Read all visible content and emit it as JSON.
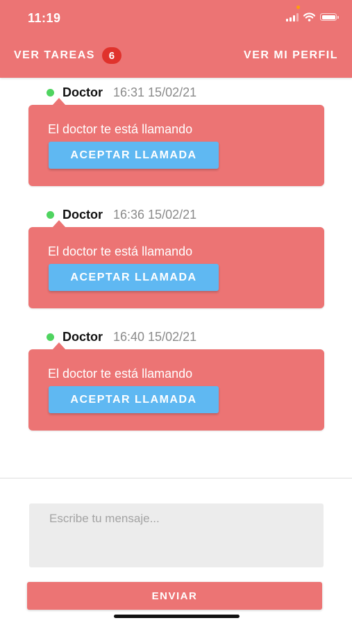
{
  "status_bar": {
    "time": "11:19",
    "icons": [
      "cellular-signal-icon",
      "wifi-icon",
      "battery-icon"
    ]
  },
  "header": {
    "tasks_label": "VER TAREAS",
    "tasks_count": "6",
    "profile_label": "VER MI PERFIL"
  },
  "messages": [
    {
      "sender": "Doctor",
      "time": "16:31 15/02/21",
      "text": "El doctor te está llamando",
      "button_label": "ACEPTAR LLAMADA"
    },
    {
      "sender": "Doctor",
      "time": "16:36 15/02/21",
      "text": "El doctor te está llamando",
      "button_label": "ACEPTAR LLAMADA"
    },
    {
      "sender": "Doctor",
      "time": "16:40 15/02/21",
      "text": "El doctor te está llamando",
      "button_label": "ACEPTAR LLAMADA"
    }
  ],
  "composer": {
    "placeholder": "Escribe tu mensaje...",
    "value": "",
    "send_label": "ENVIAR"
  },
  "colors": {
    "primary": "#ec7474",
    "badge": "#e0322c",
    "accept_button": "#5fb8f2",
    "online": "#4fd460",
    "input_background": "#ececec"
  }
}
